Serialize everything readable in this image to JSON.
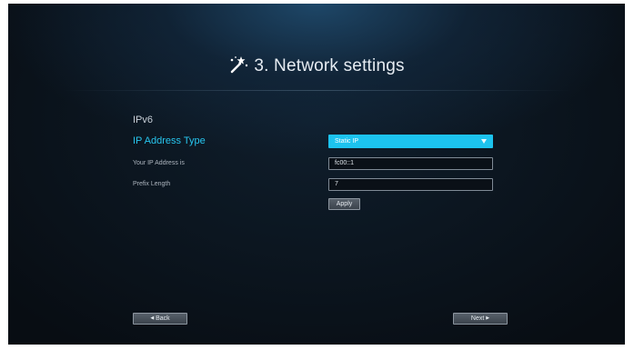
{
  "title": "3. Network settings",
  "section": "IPv6",
  "fields": {
    "ip_type_label": "IP Address Type",
    "ip_type_value": "Static IP",
    "ip_address_label": "Your IP Address is",
    "ip_address_value": "fc00::1",
    "prefix_label": "Prefix Length",
    "prefix_value": "7"
  },
  "buttons": {
    "apply": "Apply",
    "back": "Back",
    "next": "Next"
  },
  "icons": {
    "title": "magic-wand-icon",
    "back": "triangle-left-icon",
    "next": "triangle-right-icon",
    "select": "chevron-down-icon"
  },
  "colors": {
    "accent": "#1cc3ef",
    "active_label": "#27c5ee",
    "background": "#070b10"
  }
}
